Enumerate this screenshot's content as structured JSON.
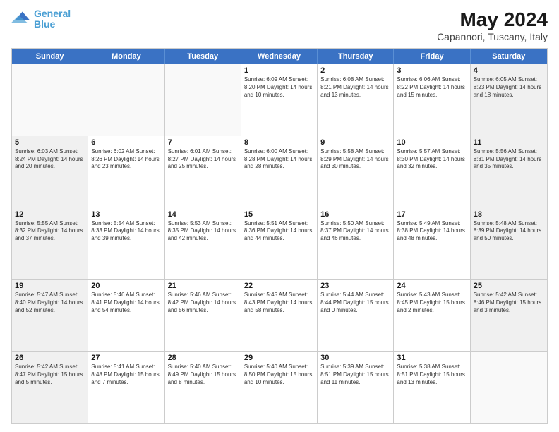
{
  "header": {
    "logo_line1": "General",
    "logo_line2": "Blue",
    "title": "May 2024",
    "subtitle": "Capannori, Tuscany, Italy"
  },
  "calendar": {
    "days_of_week": [
      "Sunday",
      "Monday",
      "Tuesday",
      "Wednesday",
      "Thursday",
      "Friday",
      "Saturday"
    ],
    "rows": [
      [
        {
          "day": "",
          "info": ""
        },
        {
          "day": "",
          "info": ""
        },
        {
          "day": "",
          "info": ""
        },
        {
          "day": "1",
          "info": "Sunrise: 6:09 AM\nSunset: 8:20 PM\nDaylight: 14 hours\nand 10 minutes."
        },
        {
          "day": "2",
          "info": "Sunrise: 6:08 AM\nSunset: 8:21 PM\nDaylight: 14 hours\nand 13 minutes."
        },
        {
          "day": "3",
          "info": "Sunrise: 6:06 AM\nSunset: 8:22 PM\nDaylight: 14 hours\nand 15 minutes."
        },
        {
          "day": "4",
          "info": "Sunrise: 6:05 AM\nSunset: 8:23 PM\nDaylight: 14 hours\nand 18 minutes."
        }
      ],
      [
        {
          "day": "5",
          "info": "Sunrise: 6:03 AM\nSunset: 8:24 PM\nDaylight: 14 hours\nand 20 minutes."
        },
        {
          "day": "6",
          "info": "Sunrise: 6:02 AM\nSunset: 8:26 PM\nDaylight: 14 hours\nand 23 minutes."
        },
        {
          "day": "7",
          "info": "Sunrise: 6:01 AM\nSunset: 8:27 PM\nDaylight: 14 hours\nand 25 minutes."
        },
        {
          "day": "8",
          "info": "Sunrise: 6:00 AM\nSunset: 8:28 PM\nDaylight: 14 hours\nand 28 minutes."
        },
        {
          "day": "9",
          "info": "Sunrise: 5:58 AM\nSunset: 8:29 PM\nDaylight: 14 hours\nand 30 minutes."
        },
        {
          "day": "10",
          "info": "Sunrise: 5:57 AM\nSunset: 8:30 PM\nDaylight: 14 hours\nand 32 minutes."
        },
        {
          "day": "11",
          "info": "Sunrise: 5:56 AM\nSunset: 8:31 PM\nDaylight: 14 hours\nand 35 minutes."
        }
      ],
      [
        {
          "day": "12",
          "info": "Sunrise: 5:55 AM\nSunset: 8:32 PM\nDaylight: 14 hours\nand 37 minutes."
        },
        {
          "day": "13",
          "info": "Sunrise: 5:54 AM\nSunset: 8:33 PM\nDaylight: 14 hours\nand 39 minutes."
        },
        {
          "day": "14",
          "info": "Sunrise: 5:53 AM\nSunset: 8:35 PM\nDaylight: 14 hours\nand 42 minutes."
        },
        {
          "day": "15",
          "info": "Sunrise: 5:51 AM\nSunset: 8:36 PM\nDaylight: 14 hours\nand 44 minutes."
        },
        {
          "day": "16",
          "info": "Sunrise: 5:50 AM\nSunset: 8:37 PM\nDaylight: 14 hours\nand 46 minutes."
        },
        {
          "day": "17",
          "info": "Sunrise: 5:49 AM\nSunset: 8:38 PM\nDaylight: 14 hours\nand 48 minutes."
        },
        {
          "day": "18",
          "info": "Sunrise: 5:48 AM\nSunset: 8:39 PM\nDaylight: 14 hours\nand 50 minutes."
        }
      ],
      [
        {
          "day": "19",
          "info": "Sunrise: 5:47 AM\nSunset: 8:40 PM\nDaylight: 14 hours\nand 52 minutes."
        },
        {
          "day": "20",
          "info": "Sunrise: 5:46 AM\nSunset: 8:41 PM\nDaylight: 14 hours\nand 54 minutes."
        },
        {
          "day": "21",
          "info": "Sunrise: 5:46 AM\nSunset: 8:42 PM\nDaylight: 14 hours\nand 56 minutes."
        },
        {
          "day": "22",
          "info": "Sunrise: 5:45 AM\nSunset: 8:43 PM\nDaylight: 14 hours\nand 58 minutes."
        },
        {
          "day": "23",
          "info": "Sunrise: 5:44 AM\nSunset: 8:44 PM\nDaylight: 15 hours\nand 0 minutes."
        },
        {
          "day": "24",
          "info": "Sunrise: 5:43 AM\nSunset: 8:45 PM\nDaylight: 15 hours\nand 2 minutes."
        },
        {
          "day": "25",
          "info": "Sunrise: 5:42 AM\nSunset: 8:46 PM\nDaylight: 15 hours\nand 3 minutes."
        }
      ],
      [
        {
          "day": "26",
          "info": "Sunrise: 5:42 AM\nSunset: 8:47 PM\nDaylight: 15 hours\nand 5 minutes."
        },
        {
          "day": "27",
          "info": "Sunrise: 5:41 AM\nSunset: 8:48 PM\nDaylight: 15 hours\nand 7 minutes."
        },
        {
          "day": "28",
          "info": "Sunrise: 5:40 AM\nSunset: 8:49 PM\nDaylight: 15 hours\nand 8 minutes."
        },
        {
          "day": "29",
          "info": "Sunrise: 5:40 AM\nSunset: 8:50 PM\nDaylight: 15 hours\nand 10 minutes."
        },
        {
          "day": "30",
          "info": "Sunrise: 5:39 AM\nSunset: 8:51 PM\nDaylight: 15 hours\nand 11 minutes."
        },
        {
          "day": "31",
          "info": "Sunrise: 5:38 AM\nSunset: 8:51 PM\nDaylight: 15 hours\nand 13 minutes."
        },
        {
          "day": "",
          "info": ""
        }
      ]
    ]
  }
}
